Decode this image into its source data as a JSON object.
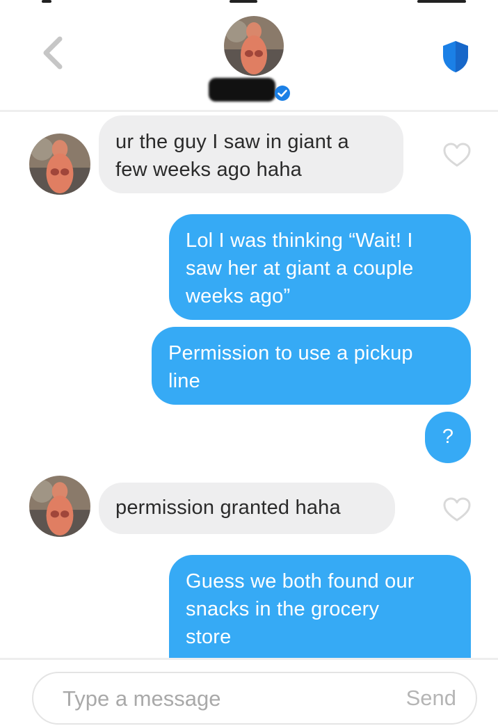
{
  "header": {
    "back_icon": "chevron-left-icon",
    "verified_icon": "verified-check-icon",
    "safety_icon": "shield-icon",
    "accent_color": "#1b80e6"
  },
  "messages": [
    {
      "direction": "in",
      "text": "ur the guy I saw in giant a\nfew weeks ago haha"
    },
    {
      "direction": "out",
      "text": "Lol I was thinking “Wait! I\nsaw her at giant a couple\nweeks ago”"
    },
    {
      "direction": "out",
      "text": "Permission to use a pickup\nline"
    },
    {
      "direction": "out",
      "text": "?"
    },
    {
      "direction": "in",
      "text": "permission granted haha"
    },
    {
      "direction": "out",
      "text": "Guess we both found our\nsnacks in the grocery\nstore"
    }
  ],
  "composer": {
    "placeholder": "Type a message",
    "send_label": "Send"
  },
  "colors": {
    "outgoing_bubble": "#36aaf5",
    "incoming_bubble": "#eeeeef",
    "heart_outline": "#d9d9d9"
  }
}
